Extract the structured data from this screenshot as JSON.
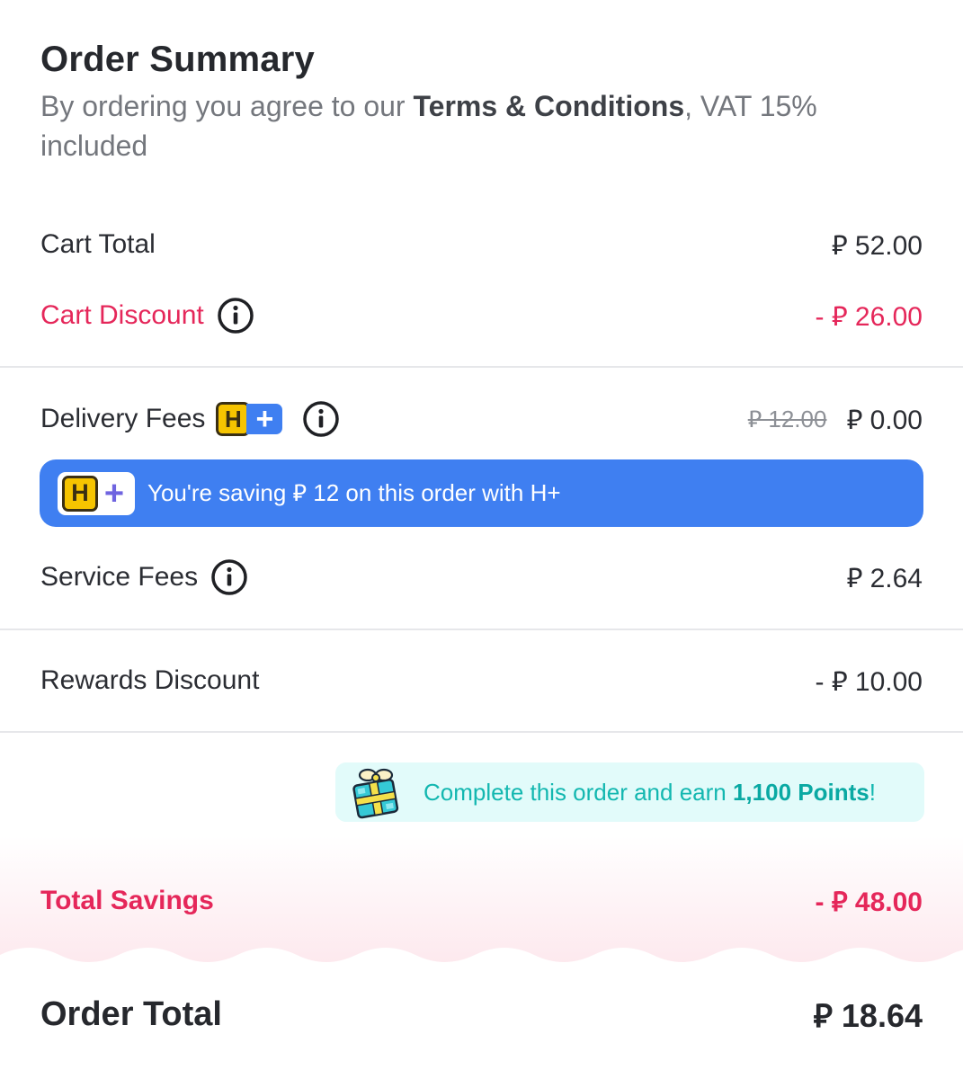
{
  "header": {
    "title": "Order Summary",
    "subtitle_prefix": "By ordering you agree to our ",
    "terms_link": "Terms & Conditions",
    "subtitle_suffix": ", VAT 15% included"
  },
  "currency_symbol": "⃁",
  "rows": {
    "cart_total": {
      "label": "Cart Total",
      "amount": "⃁ 52.00"
    },
    "cart_discount": {
      "label": "Cart Discount",
      "amount": "- ⃁ 26.00"
    },
    "delivery_fees": {
      "label": "Delivery Fees",
      "original": "⃁ 12.00",
      "amount": "⃁ 0.00"
    },
    "service_fees": {
      "label": "Service Fees",
      "amount": "⃁ 2.64"
    },
    "rewards_discount": {
      "label": "Rewards Discount",
      "amount": "- ⃁ 10.00"
    }
  },
  "hplus_badge": {
    "letter": "H",
    "plus": "+"
  },
  "hplus_banner": {
    "text": "You're saving ⃁ 12 on this order with H+"
  },
  "points_banner": {
    "prefix": "Complete this order and earn ",
    "points": "1,100 Points",
    "suffix": "!"
  },
  "totals": {
    "savings_label": "Total Savings",
    "savings_amount": "- ⃁ 48.00",
    "order_label": "Order Total",
    "order_amount": "⃁ 18.64"
  },
  "colors": {
    "accent_pink": "#e5275a",
    "hplus_blue": "#3f7ff1",
    "hplus_yellow": "#f6c400",
    "points_teal": "#13b7b0",
    "points_bg": "#e2fbfa"
  },
  "icons": [
    "info-icon",
    "hplus-badge-icon",
    "gift-icon"
  ]
}
